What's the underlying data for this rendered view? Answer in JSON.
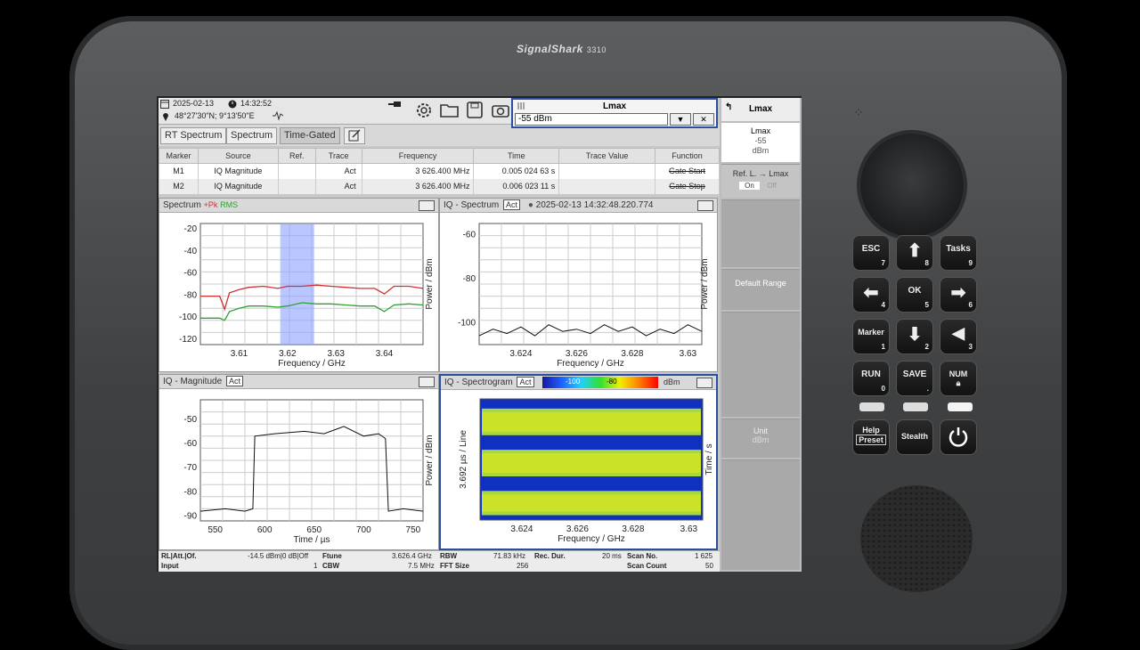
{
  "device": {
    "brand": "SignalShark",
    "model": "3310"
  },
  "status": {
    "date": "2025-02-13",
    "time": "14:32:52",
    "location": "48°27'30\"N; 9°13'50\"E"
  },
  "tabs": [
    {
      "label": "RT Spectrum"
    },
    {
      "label": "Spectrum"
    },
    {
      "label": "Time-Gated"
    }
  ],
  "lmax_popup": {
    "title": "Lmax",
    "value": "-55 dBm",
    "dropdown": "▼",
    "close": "✕"
  },
  "marker_table": {
    "headers": [
      "Marker",
      "Source",
      "Ref.",
      "Trace",
      "Frequency",
      "Time",
      "Trace Value",
      "Function"
    ],
    "rows": [
      [
        "M1",
        "IQ Magnitude",
        "",
        "Act",
        "3 626.400 MHz",
        "0.005 024 63 s",
        "",
        "Gate Start"
      ],
      [
        "M2",
        "IQ Magnitude",
        "",
        "Act",
        "3 626.400 MHz",
        "0.006 023 11 s",
        "",
        "Gate Stop"
      ]
    ]
  },
  "panels": {
    "spectrum": {
      "title": "Spectrum",
      "pk": "+Pk",
      "rms": "RMS",
      "xlabel": "Frequency / GHz",
      "ylabel": "Power / dBm",
      "xticks": [
        "3.61",
        "3.62",
        "3.63",
        "3.64"
      ],
      "yticks": [
        "-20",
        "-40",
        "-60",
        "-80",
        "-100",
        "-120"
      ]
    },
    "iq_spectrum": {
      "title": "IQ - Spectrum",
      "act": "Act",
      "timestamp": "2025-02-13 14:32:48.220.774",
      "xlabel": "Frequency / GHz",
      "ylabel": "Power / dBm",
      "xticks": [
        "3.624",
        "3.626",
        "3.628",
        "3.63"
      ],
      "yticks": [
        "-60",
        "-80",
        "-100"
      ]
    },
    "iq_magnitude": {
      "title": "IQ - Magnitude",
      "act": "Act",
      "xlabel": "Time / µs",
      "ylabel": "Power / dBm",
      "xticks": [
        "550",
        "600",
        "650",
        "700",
        "750"
      ],
      "yticks": [
        "-50",
        "-60",
        "-70",
        "-80",
        "-90"
      ]
    },
    "iq_spectrogram": {
      "title": "IQ - Spectrogram",
      "act": "Act",
      "scale_low": "-100",
      "scale_high": "-80",
      "scale_unit": "dBm",
      "xlabel": "Frequency / GHz",
      "ylabel": "3.692 µs / Line",
      "ylabel_right": "Time / s",
      "xticks": [
        "3.624",
        "3.626",
        "3.628",
        "3.63"
      ]
    }
  },
  "chart_data": [
    {
      "type": "line",
      "title": "Spectrum",
      "xlabel": "Frequency / GHz",
      "ylabel": "Power / dBm",
      "xlim": [
        3.602,
        3.648
      ],
      "ylim": [
        -125,
        -15
      ],
      "series": [
        {
          "name": "+Pk",
          "color": "#d03030",
          "x": [
            3.602,
            3.606,
            3.607,
            3.608,
            3.61,
            3.612,
            3.615,
            3.618,
            3.62,
            3.623,
            3.626,
            3.629,
            3.632,
            3.635,
            3.638,
            3.64,
            3.642,
            3.645,
            3.648
          ],
          "y": [
            -81,
            -81,
            -93,
            -78,
            -75,
            -73,
            -72,
            -74,
            -72,
            -72,
            -71,
            -72,
            -73,
            -74,
            -74,
            -79,
            -72,
            -72,
            -74
          ]
        },
        {
          "name": "RMS",
          "color": "#30a030",
          "x": [
            3.602,
            3.606,
            3.607,
            3.608,
            3.61,
            3.612,
            3.615,
            3.618,
            3.62,
            3.623,
            3.626,
            3.629,
            3.632,
            3.635,
            3.638,
            3.64,
            3.642,
            3.645,
            3.648
          ],
          "y": [
            -101,
            -101,
            -103,
            -95,
            -92,
            -90,
            -90,
            -91,
            -90,
            -87,
            -88,
            -88,
            -89,
            -90,
            -90,
            -95,
            -89,
            -88,
            -89
          ]
        }
      ],
      "gate_band": [
        3.6185,
        3.6255
      ]
    },
    {
      "type": "line",
      "title": "IQ - Spectrum",
      "xlabel": "Frequency / GHz",
      "ylabel": "Power / dBm",
      "xlim": [
        3.6225,
        3.6305
      ],
      "ylim": [
        -110,
        -55
      ],
      "series": [
        {
          "name": "",
          "color": "#111111",
          "x": [
            3.6225,
            3.623,
            3.6235,
            3.624,
            3.6245,
            3.625,
            3.6255,
            3.626,
            3.6265,
            3.627,
            3.6275,
            3.628,
            3.6285,
            3.629,
            3.6295,
            3.63,
            3.6305
          ],
          "y": [
            -106,
            -103,
            -105,
            -102,
            -106,
            -101,
            -104,
            -103,
            -105,
            -101,
            -104,
            -102,
            -106,
            -103,
            -105,
            -101,
            -104
          ]
        }
      ]
    },
    {
      "type": "line",
      "title": "IQ - Magnitude",
      "xlabel": "Time / µs",
      "ylabel": "Power / dBm",
      "xlim": [
        535,
        760
      ],
      "ylim": [
        -92,
        -42
      ],
      "series": [
        {
          "name": "",
          "color": "#111111",
          "x": [
            535,
            560,
            580,
            588,
            590,
            610,
            640,
            660,
            680,
            700,
            715,
            722,
            725,
            740,
            760
          ],
          "y": [
            -88,
            -87,
            -88,
            -87,
            -57,
            -56,
            -55,
            -56,
            -53,
            -57,
            -56,
            -58,
            -88,
            -87,
            -88
          ]
        }
      ]
    },
    {
      "type": "heatmap",
      "title": "IQ - Spectrogram",
      "xlabel": "Frequency / GHz",
      "ylabel": "3.692 µs / Line",
      "xlim": [
        3.6225,
        3.6305
      ],
      "color_range": [
        -100,
        -80
      ],
      "color_unit": "dBm"
    }
  ],
  "softkeys": {
    "title": "Lmax",
    "lmax_label": "Lmax",
    "lmax_value": "-55",
    "lmax_unit": "dBm",
    "ref_label": "Ref. L. → Lmax",
    "on": "On",
    "off": "Off",
    "default_range": "Default Range",
    "unit": "Unit",
    "unit_value": "dBm"
  },
  "bottombar": {
    "rl_label": "RL|Att.|Of.",
    "rl_value": "-14.5 dBm|0 dB|Off",
    "input_label": "Input",
    "input_value": "1",
    "ftune_label": "Ftune",
    "ftune_value": "3.626.4 GHz",
    "cbw_label": "CBW",
    "cbw_value": "7.5 MHz",
    "rbw_label": "RBW",
    "rbw_value": "71.83 kHz",
    "fft_label": "FFT Size",
    "fft_value": "256",
    "rec_label": "Rec. Dur.",
    "rec_value": "20 ms",
    "scanno_label": "Scan No.",
    "scanno_value": "1 625",
    "scancount_label": "Scan Count",
    "scancount_value": "50"
  },
  "keys": {
    "esc": "ESC",
    "esc_n": "7",
    "up_n": "8",
    "tasks": "Tasks",
    "tasks_n": "9",
    "left_n": "4",
    "ok": "OK",
    "ok_n": "5",
    "right_n": "6",
    "marker": "Marker",
    "marker_n": "1",
    "down_n": "2",
    "vol_n": "3",
    "run": "RUN",
    "run_n": "0",
    "save": "SAVE",
    "save_n": ".",
    "num": "NUM",
    "help": "Help",
    "preset": "Preset",
    "stealth": "Stealth"
  }
}
